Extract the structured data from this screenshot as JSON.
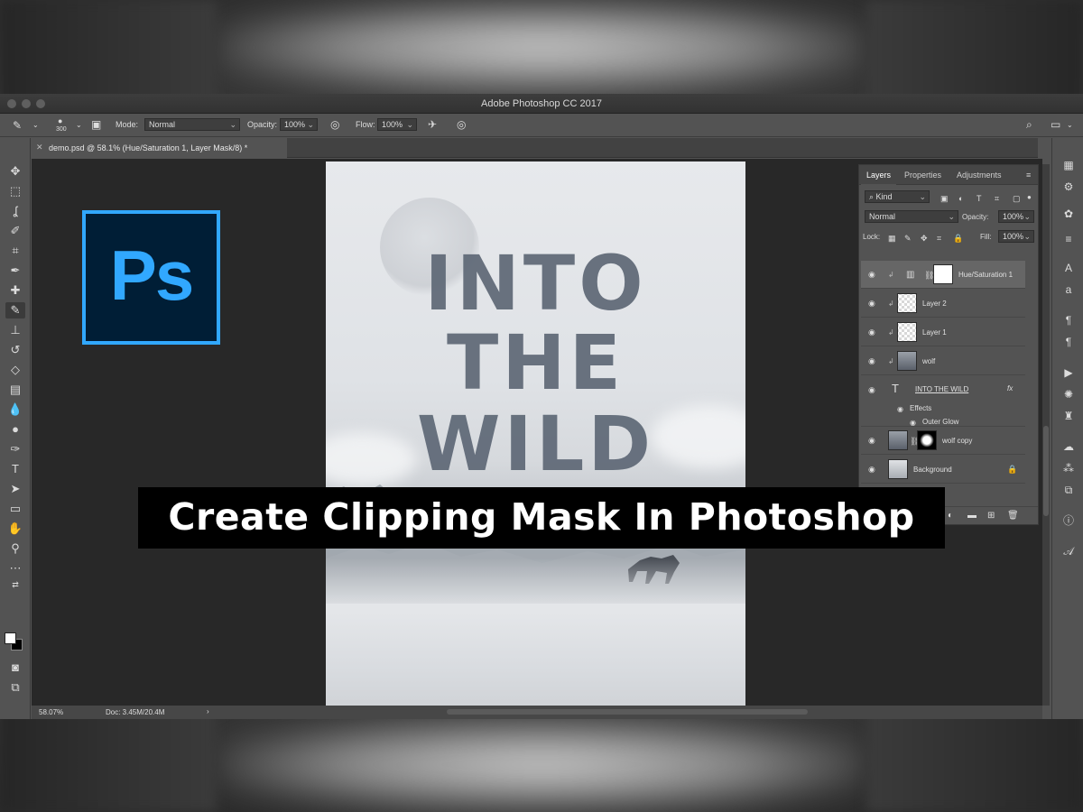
{
  "app": {
    "window_title": "Adobe Photoshop CC 2017",
    "logo_text": "Ps"
  },
  "options_bar": {
    "brush_size": "300",
    "mode_label": "Mode:",
    "mode_value": "Normal",
    "opacity_label": "Opacity:",
    "opacity_value": "100%",
    "flow_label": "Flow:",
    "flow_value": "100%"
  },
  "document": {
    "tab_title": "demo.psd @ 58.1% (Hue/Saturation 1, Layer Mask/8) *",
    "headline_lines": [
      "INTO",
      "THE",
      "WILD"
    ]
  },
  "status_bar": {
    "zoom": "58.07%",
    "doc_size": "Doc: 3.45M/20.4M",
    "arrow": "›"
  },
  "layers_panel": {
    "tabs": [
      "Layers",
      "Properties",
      "Adjustments"
    ],
    "filter_label": "Kind",
    "blend_mode": "Normal",
    "opacity_label": "Opacity:",
    "opacity_value": "100%",
    "lock_label": "Lock:",
    "fill_label": "Fill:",
    "fill_value": "100%",
    "layers": [
      {
        "name": "Hue/Saturation 1"
      },
      {
        "name": "Layer 2"
      },
      {
        "name": "Layer 1"
      },
      {
        "name": "wolf"
      },
      {
        "name": "INTO THE WILD",
        "fx": "fx",
        "effects_label": "Effects",
        "effect": "Outer Glow"
      },
      {
        "name": "wolf copy"
      },
      {
        "name": "Background"
      }
    ]
  },
  "caption": {
    "text": "Create Clipping Mask In Photoshop"
  },
  "colors": {
    "ps_blue": "#31a8ff",
    "ps_navy": "#001e36",
    "ui_gray": "#535353"
  },
  "icons": [
    "move-icon",
    "marquee-icon",
    "lasso-icon",
    "quick-select-icon",
    "crop-icon",
    "eyedropper-icon",
    "healing-icon",
    "brush-icon",
    "stamp-icon",
    "history-brush-icon",
    "eraser-icon",
    "gradient-icon",
    "blur-icon",
    "dodge-icon",
    "pen-icon",
    "type-icon",
    "path-select-icon",
    "rectangle-icon",
    "hand-icon",
    "zoom-icon",
    "eye-icon",
    "lock-icon",
    "search-icon"
  ]
}
